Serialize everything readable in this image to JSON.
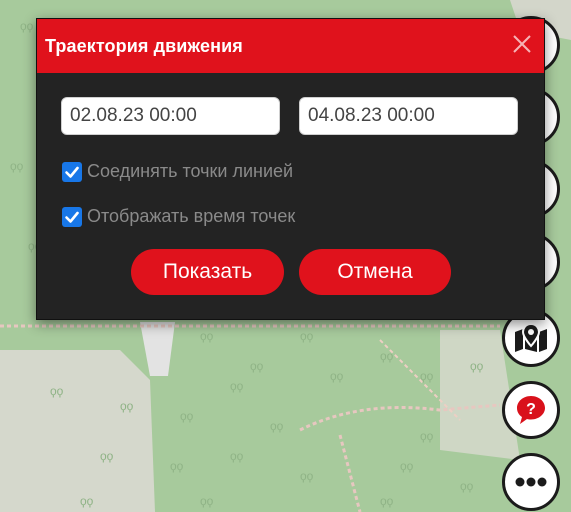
{
  "dialog": {
    "title": "Траектория движения",
    "date_from": "02.08.23 00:00",
    "date_to": "04.08.23 00:00",
    "options": [
      {
        "label": "Соединять точки линией",
        "checked": true
      },
      {
        "label": "Отображать время точек",
        "checked": true
      }
    ],
    "show_button": "Показать",
    "cancel_button": "Отмена"
  },
  "side_buttons": [
    "map-marker-icon",
    "question-icon",
    "more-icon"
  ],
  "colors": {
    "accent_red": "#e0121c",
    "dialog_bg": "#232323",
    "checkbox_blue": "#1877e8",
    "map_forest": "#a6c99b",
    "map_clearing": "#d7d9d0"
  }
}
